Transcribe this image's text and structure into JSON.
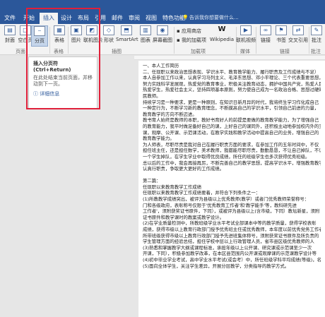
{
  "tabs": [
    "文件",
    "开始",
    "插入",
    "设计",
    "布局",
    "引用",
    "邮件",
    "审阅",
    "视图",
    "特色功能"
  ],
  "active_tab": "插入",
  "tell_me": "告诉我你想要做什么...",
  "ribbon": {
    "cover": "封面",
    "blank_page": "空白页",
    "page_break": "分页",
    "table": "表格",
    "picture": "图片",
    "online_picture": "联机图片",
    "shapes": "形状",
    "smartart": "SmartArt",
    "chart": "图表",
    "screenshot": "屏幕截图",
    "app_store": "应用商店",
    "my_addins": "我的加载项",
    "wikipedia": "Wikipedia",
    "online_video": "联机视频",
    "link": "链接",
    "bookmark": "书签",
    "cross_ref": "交叉引用",
    "comment": "批注",
    "group_pages": "页面",
    "group_tables": "表格",
    "group_illustrations": "插图",
    "group_addins": "加载项",
    "group_media": "媒体",
    "group_links": "链接",
    "group_comments": "批注"
  },
  "tooltip": {
    "title": "插入分页符 (Ctrl+Return)",
    "desc": "在此处结束当前页面，并移动到下一页。",
    "link": "详细信息"
  },
  "doc_lines": [
    "一、本人工作简历",
    "二、任现职以来政治思想表现、学识水平、教育教学能力、履行职责及工作成绩与不足）",
    "本人自参加工作以来，认真学习马列主义、毛泽东思想、邓小平理论、三个代表重要思想，",
    "努力实践科学发展观，热爱党的教育事业，积极关注教育动态，拥护中国共产党，热爱人民",
    "热爱学生，热爱社会主义，坚持四项基本原则，努力使自己成为一名政治合格、思想过硬的人",
    "民教师。",
    "持续学习是一种要求，更是一种原则，在知识日新月异的时代，我将终生学习作化成自己",
    "一种定行为，不断学习新的教育理念，不断摸高自己的学识水平，引领自己前进的力量，",
    "教育教学的方向不断迈进。",
    "教书育人始终是教师的本职，教好书育好人的前提是要做的教育教学能力，为了增强自己",
    "的教育能力，我平时做足备好自己的课，上好自己的课同外，还积极主动地参加校内外的交流",
    "课，观摩、公开课、示范课活动，在教学实践和教学活动中提高自己的业务，增强自己的",
    "教育教学能力。",
    "为人师表，尽职尽责是我对自己在履行职责方面的要求，在参加工作的五年时间中，不仅",
    "担任班主任，还是担任数学，美术教师，我都能尽职尽责，勤勤恳恳，不让自己掉队，不让",
    "一个学生掉队，在学生学业中取得优良成绩，所任的班级学生也多次获得优秀班级。",
    "总以后的工作中，我会再接再厉，不断完善自己的教学思想，提高学识水平，增强教育教学能力，",
    "认真行职责，争取更大更好的工作成绩。",
    "",
    "第二篇：",
    "任现职以来教育教学工作成绩",
    "任现职以来教育教学工作成绩要着，并符合下列条件之一：",
    "(1)所教教学成绩突出，被评为县级以上优秀教师(教学）或者门优秀教师荣誉称号：",
    "门和各级政府，表彰称号仅限于'优秀教育工作者'和'教学能手'等，教科研先进",
    "工作者'，须附获奖证书原件，下同），或被评为县级以上(含市级，下同）教坛新星，须附",
    "证书原件和教学课时的教案或教学设计。",
    "(2)在学业质量检测中，所教班级学业水平考试全部课本中等的教学质量，获得学校表彰",
    "成绩，获得市级以上教育行政部门授予优秀班主任或优秀教师，本年度以前优秀党务工作者",
    "所带班级获得市级以上教育行政部门授予先进班集体称号，须附获奖证书原件及所负责的",
    "学生管理方面的经验总结，担任学校中层以上行政管理人员，省市县区级优秀教师的人",
    "(3)熟悉和掌握教学大纲或课程标准，承担年级以上公开课、研究课或示范课至少一次",
    "开课，下同），积极参加教学改革，在本区县范围内公开课或观摩课的示范课教学设计等",
    "(4)初中毕业学业考试，高中学业水平考试(或会考）中，所任班级学科平均成绩(等级)，名",
    "(5)面向全体学生，关注学生差异，开展分层教学，分类指导的教学方式。"
  ]
}
